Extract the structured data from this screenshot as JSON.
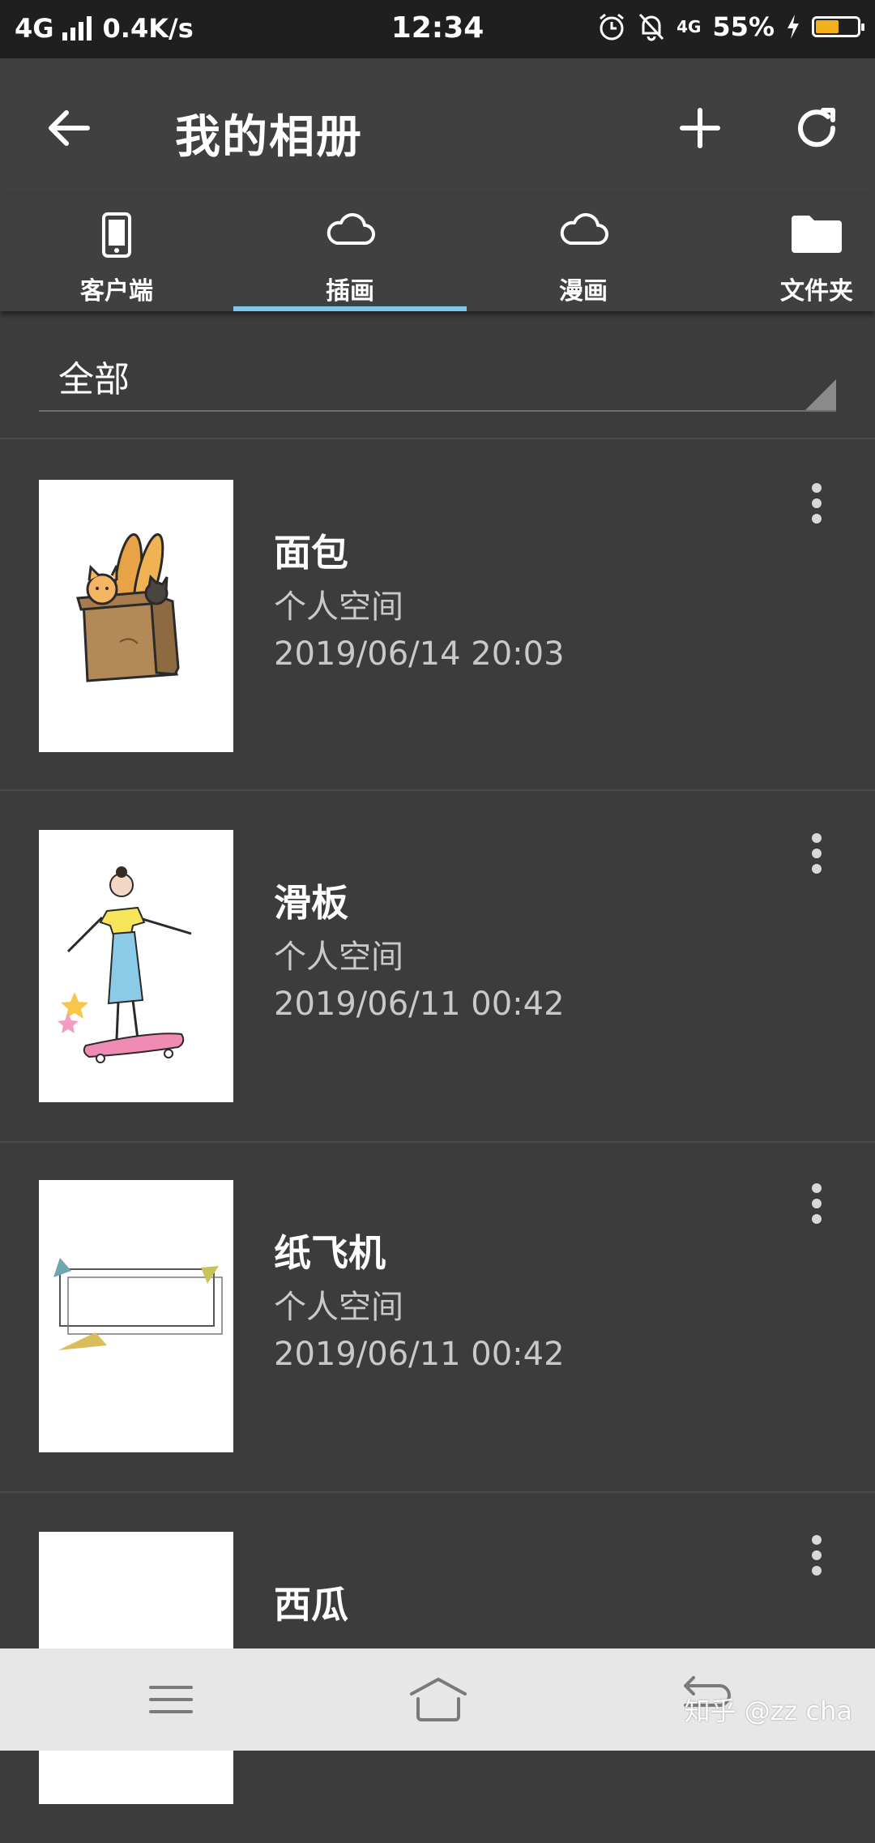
{
  "status_bar": {
    "network": "4G",
    "speed": "0.4K/s",
    "time": "12:34",
    "net2": "4G",
    "battery_text": "55%",
    "battery_level": 0.55,
    "battery_color": "#f2b01e"
  },
  "toolbar": {
    "title": "我的相册",
    "back_icon": "arrow-left-icon",
    "add_icon": "plus-icon",
    "refresh_icon": "refresh-icon"
  },
  "tabs": [
    {
      "label": "客户端",
      "icon": "phone-icon",
      "active": false
    },
    {
      "label": "插画",
      "icon": "cloud-icon",
      "active": true
    },
    {
      "label": "漫画",
      "icon": "cloud-icon",
      "active": false
    },
    {
      "label": "文件夹",
      "icon": "folder-icon",
      "active": false
    }
  ],
  "accent_color": "#7fc8ea",
  "filter": {
    "label": "全部"
  },
  "items": [
    {
      "title": "面包",
      "location": "个人空间",
      "date": "2019/06/14 20:03",
      "thumb": "bread-bag-cats"
    },
    {
      "title": "滑板",
      "location": "个人空间",
      "date": "2019/06/11 00:42",
      "thumb": "girl-on-skateboard"
    },
    {
      "title": "纸飞机",
      "location": "个人空间",
      "date": "2019/06/11 00:42",
      "thumb": "paper-plane-frame"
    },
    {
      "title": "西瓜",
      "location": "",
      "date": "",
      "thumb": "blank"
    }
  ],
  "navbar": {
    "menu_icon": "menu-icon",
    "home_icon": "home-icon",
    "back_icon": "back-icon",
    "watermark": "知乎 @zz cha"
  }
}
